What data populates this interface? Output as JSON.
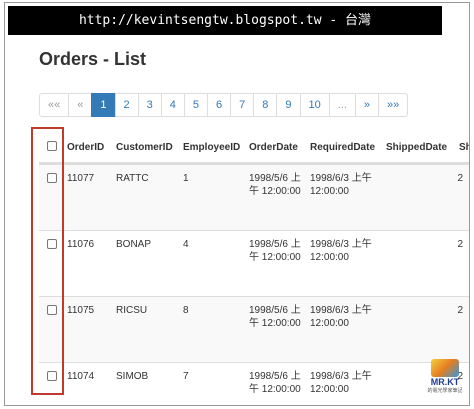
{
  "banner": {
    "text": "http://kevintsengtw.blogspot.tw - 台灣"
  },
  "page_title": "Orders - List",
  "pagination": [
    {
      "label": "««",
      "state": "disabled"
    },
    {
      "label": "«",
      "state": "disabled"
    },
    {
      "label": "1",
      "state": "active"
    },
    {
      "label": "2",
      "state": "normal"
    },
    {
      "label": "3",
      "state": "normal"
    },
    {
      "label": "4",
      "state": "normal"
    },
    {
      "label": "5",
      "state": "normal"
    },
    {
      "label": "6",
      "state": "normal"
    },
    {
      "label": "7",
      "state": "normal"
    },
    {
      "label": "8",
      "state": "normal"
    },
    {
      "label": "9",
      "state": "normal"
    },
    {
      "label": "10",
      "state": "normal"
    },
    {
      "label": "...",
      "state": "disabled"
    },
    {
      "label": "»",
      "state": "normal"
    },
    {
      "label": "»»",
      "state": "normal"
    }
  ],
  "table": {
    "headers": {
      "order_id": "OrderID",
      "customer_id": "CustomerID",
      "employee_id": "EmployeeID",
      "order_date": "OrderDate",
      "required_date": "RequiredDate",
      "shipped_date": "ShippedDate",
      "ship_via": "Sh"
    },
    "rows": [
      {
        "order_id": "11077",
        "customer_id": "RATTC",
        "employee_id": "1",
        "order_date": "1998/5/6 上午 12:00:00",
        "required_date": "1998/6/3 上午 12:00:00",
        "ship_via": "2"
      },
      {
        "order_id": "11076",
        "customer_id": "BONAP",
        "employee_id": "4",
        "order_date": "1998/5/6 上午 12:00:00",
        "required_date": "1998/6/3 上午 12:00:00",
        "ship_via": "2"
      },
      {
        "order_id": "11075",
        "customer_id": "RICSU",
        "employee_id": "8",
        "order_date": "1998/5/6 上午 12:00:00",
        "required_date": "1998/6/3 上午 12:00:00",
        "ship_via": "2"
      },
      {
        "order_id": "11074",
        "customer_id": "SIMOB",
        "employee_id": "7",
        "order_date": "1998/5/6 上午 12:00:00",
        "required_date": "1998/6/3 上午 12:00:00",
        "ship_via": "2"
      }
    ]
  },
  "logo": {
    "mark": "MR.KT",
    "sub": "的電光學家筆記"
  },
  "colors": {
    "accent": "#337ab7",
    "highlight": "#c0392b",
    "banner_bg": "#000000"
  }
}
